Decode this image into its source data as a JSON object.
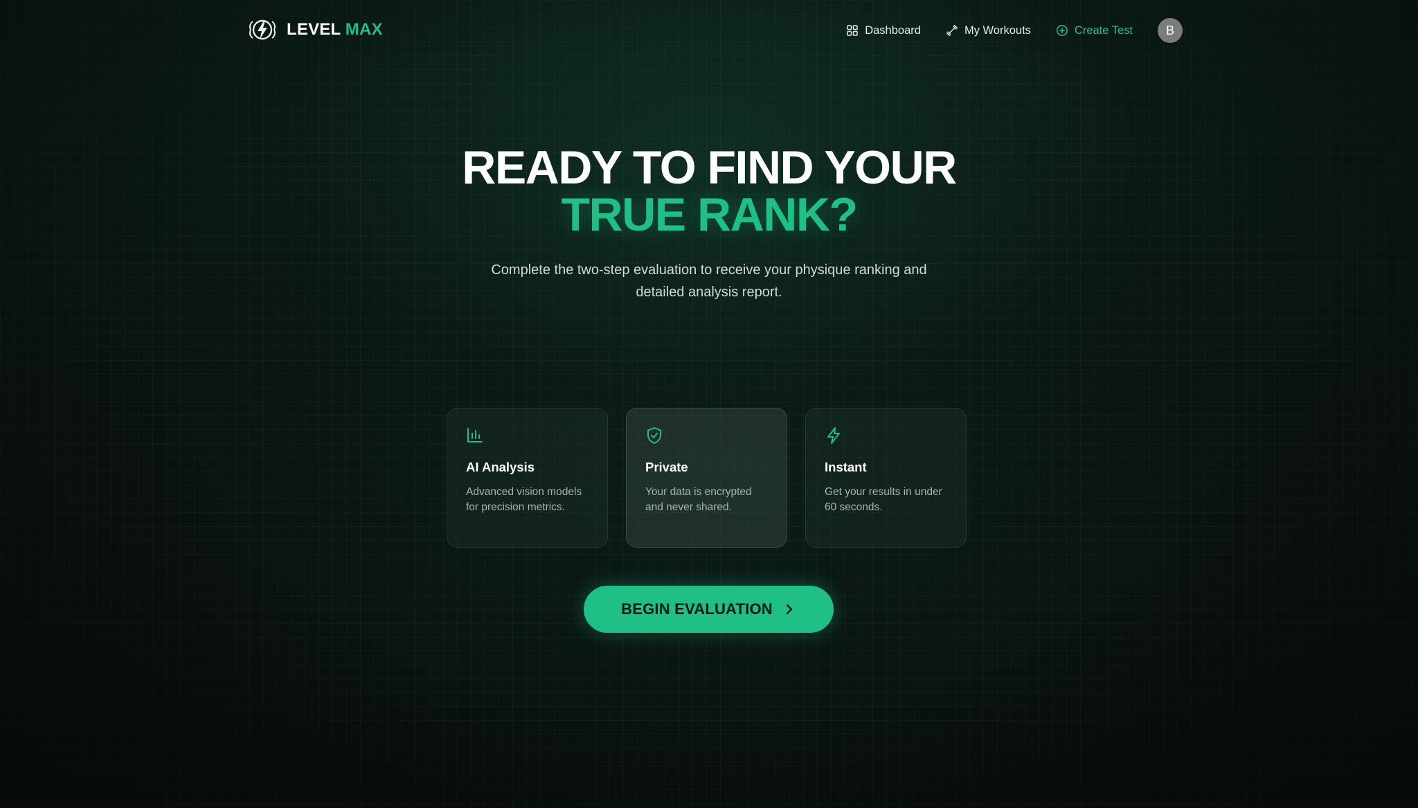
{
  "brand": {
    "name_part1": "LEVEL",
    "name_part2": "MAX"
  },
  "nav": {
    "dashboard": "Dashboard",
    "workouts": "My Workouts",
    "create_test": "Create Test",
    "avatar_initial": "B"
  },
  "hero": {
    "title_line1": "READY TO FIND YOUR",
    "title_line2": "TRUE RANK?",
    "subtitle": "Complete the two-step evaluation to receive your physique ranking and detailed analysis report."
  },
  "features": [
    {
      "icon": "bar-chart-icon",
      "title": "AI Analysis",
      "desc": "Advanced vision models for precision metrics."
    },
    {
      "icon": "shield-check-icon",
      "title": "Private",
      "desc": "Your data is encrypted and never shared."
    },
    {
      "icon": "lightning-icon",
      "title": "Instant",
      "desc": "Get your results in under 60 seconds."
    }
  ],
  "cta": {
    "label": "BEGIN EVALUATION"
  },
  "colors": {
    "accent": "#1fbf86",
    "background": "#0b1412",
    "text": "#ffffff",
    "muted": "#a9b4b0"
  }
}
